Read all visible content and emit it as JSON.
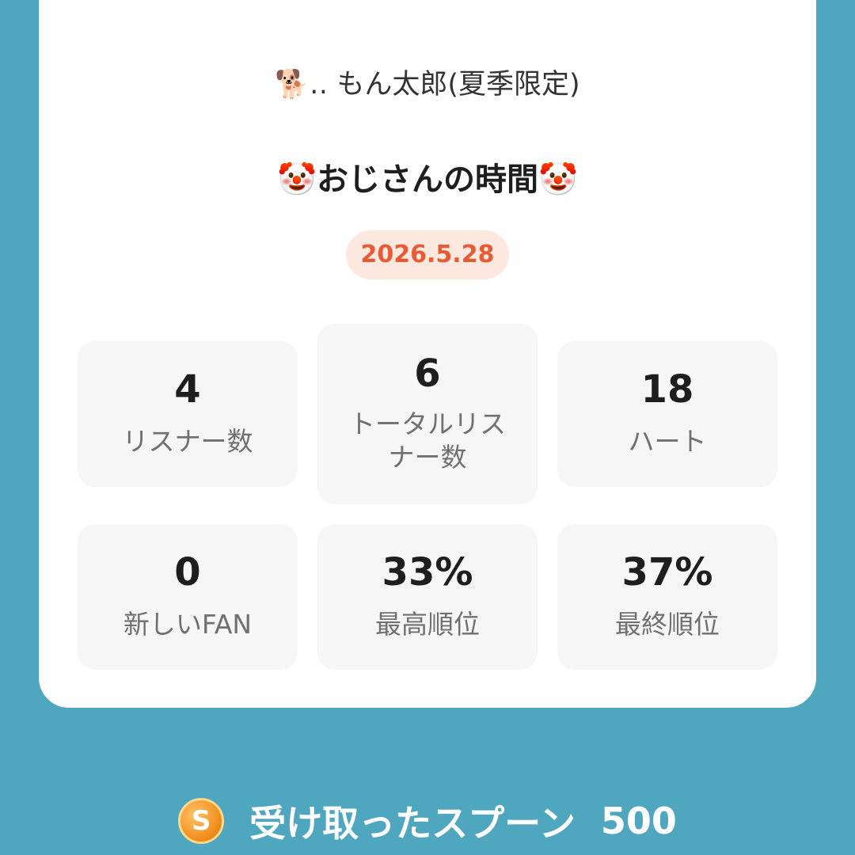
{
  "header": {
    "username": "🐕‍‥ もん太郎(夏季限定)",
    "title": "🤡おじさんの時間🤡",
    "date": "2026.5.28"
  },
  "stats": [
    {
      "value": "4",
      "label": "リスナー数"
    },
    {
      "value": "6",
      "label": "トータルリスナー数"
    },
    {
      "value": "18",
      "label": "ハート"
    },
    {
      "value": "0",
      "label": "新しいFAN"
    },
    {
      "value": "33%",
      "label": "最高順位"
    },
    {
      "value": "37%",
      "label": "最終順位"
    }
  ],
  "footer": {
    "coin_icon": "S",
    "label": "受け取ったスプーン",
    "amount": "500"
  },
  "colors": {
    "background": "#4ea7bf",
    "accent": "#e85a33",
    "pill_bg": "#fde8e0",
    "coin": "#f08a1a"
  }
}
